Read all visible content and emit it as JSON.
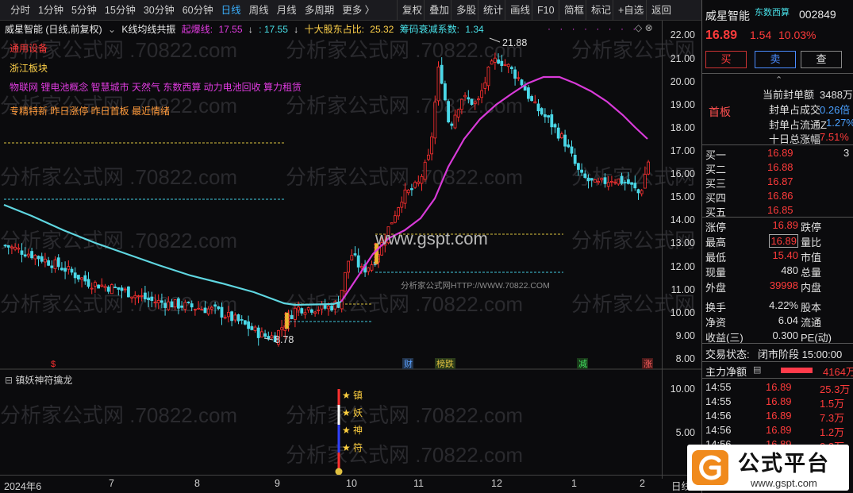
{
  "toolbar": {
    "tabs": [
      "分时",
      "1分钟",
      "5分钟",
      "15分钟",
      "30分钟",
      "60分钟",
      "日线",
      "周线",
      "月线",
      "多周期",
      "更多 〉"
    ],
    "right_buttons": [
      "复权",
      "叠加",
      "多股",
      "统计",
      "画线",
      "F10",
      "简框",
      "标记",
      "+自选",
      "返回"
    ]
  },
  "header": {
    "title": "威星智能 (日线,前复权)",
    "indicator": "K线均线共振",
    "qibao_label": "起爆线:",
    "qibao_value": "17.55",
    "qibao_value2": ": 17.55",
    "top10_label": "十大股东占比:",
    "top10_value": "25.32",
    "chip_label": "筹码衰减系数:",
    "chip_value": "1.34"
  },
  "tags": {
    "industry": "通用设备",
    "region": "浙江板块",
    "concepts": "物联网 锂电池概念 智慧城市 天然气 东数西算 动力电池回收 算力租赁",
    "special": "专精特新 昨日涨停 昨日首板 最近情绪"
  },
  "price_axis": [
    "22.00",
    "21.00",
    "20.00",
    "19.00",
    "18.00",
    "17.00",
    "16.00",
    "15.00",
    "14.00",
    "13.00",
    "12.00",
    "11.00",
    "10.00",
    "9.00",
    "8.00"
  ],
  "annotations": {
    "high": "21.88",
    "low": "8.78",
    "watermark": "www.gspt.com",
    "watermark_small": "分析家公式网HTTP://WWW.70822.COM",
    "bg_watermark": "分析家公式网 .70822.com",
    "event_cai": "财",
    "event_lb": "榜跌",
    "event_jian": "减",
    "event_zhang": "涨"
  },
  "subpanel": {
    "title": "镇妖神符擒龙",
    "axis": [
      "10.00",
      "5.00"
    ],
    "labels": [
      "镇",
      "妖",
      "神",
      "符"
    ],
    "star": "★"
  },
  "x_axis": [
    "2024年6",
    "7",
    "8",
    "9",
    "10",
    "11",
    "12",
    "1",
    "2"
  ],
  "x_axis_end": "日线",
  "quote": {
    "name": "威星智能",
    "concept_tag": "东数西算",
    "code": "002849",
    "price": "16.89",
    "change": "1.54",
    "pct": "10.03%",
    "buy_btn": "买",
    "sell_btn": "卖",
    "check_btn": "查",
    "board": "首板",
    "seal_amount_label": "当前封单额",
    "seal_amount": "3488万",
    "seal_vol_label": "封单占成交",
    "seal_vol": "0.26倍",
    "seal_float_label": "封单占流通Z",
    "seal_float": "1.27%",
    "ten_day_label": "十日总涨幅",
    "ten_day": "7.51%",
    "bids": [
      {
        "label": "买一",
        "price": "16.89",
        "vol": "3"
      },
      {
        "label": "买二",
        "price": "16.88",
        "vol": ""
      },
      {
        "label": "买三",
        "price": "16.87",
        "vol": ""
      },
      {
        "label": "买四",
        "price": "16.86",
        "vol": ""
      },
      {
        "label": "买五",
        "price": "16.85",
        "vol": ""
      }
    ],
    "stats": [
      {
        "l": "涨停",
        "v": "16.89",
        "r": "跌停"
      },
      {
        "l": "最高",
        "v": "16.89",
        "r": "量比"
      },
      {
        "l": "最低",
        "v": "15.40",
        "r": "市值"
      },
      {
        "l": "现量",
        "v": "480",
        "r": "总量"
      },
      {
        "l": "外盘",
        "v": "39998",
        "r": "内盘"
      },
      {
        "l": "换手",
        "v": "4.22%",
        "r": "股本"
      },
      {
        "l": "净资",
        "v": "6.04",
        "r": "流通"
      },
      {
        "l": "收益(三)",
        "v": "0.300",
        "r": "PE(动)"
      }
    ],
    "trade_status_label": "交易状态:",
    "trade_status": "闭市阶段 15:00:00",
    "main_flow_label": "主力净额",
    "main_flow": "4164万",
    "ticks": [
      {
        "t": "14:55",
        "p": "16.89",
        "v": "25.3万"
      },
      {
        "t": "14:55",
        "p": "16.89",
        "v": "1.5万"
      },
      {
        "t": "14:56",
        "p": "16.89",
        "v": "7.3万"
      },
      {
        "t": "14:56",
        "p": "16.89",
        "v": "1.2万"
      },
      {
        "t": "14:56",
        "p": "16.89",
        "v": "0.3万"
      }
    ]
  },
  "badge": {
    "text": "公式平台",
    "url": "www.gspt.com"
  }
}
